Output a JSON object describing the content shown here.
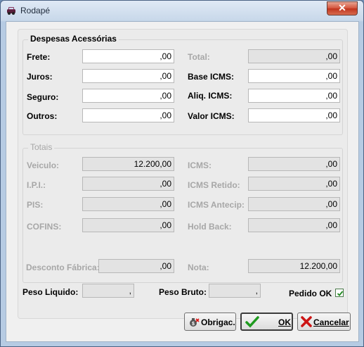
{
  "window": {
    "title": "Rodapé",
    "close_glyph": "✕"
  },
  "despesas": {
    "title": "Despesas Acessórias",
    "left": [
      {
        "label": "Frete:",
        "value": ",00"
      },
      {
        "label": "Juros:",
        "value": ",00"
      },
      {
        "label": "Seguro:",
        "value": ",00"
      },
      {
        "label": "Outros:",
        "value": ",00"
      }
    ],
    "right": [
      {
        "label": "Total:",
        "value": ",00"
      },
      {
        "label": "Base ICMS:",
        "value": ",00"
      },
      {
        "label": "Aliq. ICMS:",
        "value": ",00"
      },
      {
        "label": "Valor ICMS:",
        "value": ",00"
      }
    ]
  },
  "totais": {
    "title": "Totais",
    "left": [
      {
        "label": "Veiculo:",
        "value": "12.200,00"
      },
      {
        "label": "I.P.I.:",
        "value": ",00"
      },
      {
        "label": "PIS:",
        "value": ",00"
      },
      {
        "label": "COFINS:",
        "value": ",00"
      }
    ],
    "right": [
      {
        "label": "ICMS:",
        "value": ",00"
      },
      {
        "label": "ICMS Retido:",
        "value": ",00"
      },
      {
        "label": "ICMS Antecip:",
        "value": ",00"
      },
      {
        "label": "Hold Back:",
        "value": ",00"
      }
    ],
    "desconto": {
      "label": "Desconto Fábrica:",
      "value": ",00"
    },
    "nota": {
      "label": "Nota:",
      "value": "12.200,00"
    }
  },
  "footer": {
    "peso_liquido": {
      "label": "Peso Liquido:",
      "value": ","
    },
    "peso_bruto": {
      "label": "Peso Bruto:",
      "value": ","
    },
    "pedido_ok": {
      "label": "Pedido OK",
      "checked": true
    }
  },
  "buttons": {
    "obrigac": "Obrigac.",
    "ok": "OK",
    "cancelar": "Cancelar"
  },
  "icons": {
    "app": "car-icon",
    "obrigac": "money-bag-icon",
    "ok": "green-check-icon",
    "cancelar": "red-x-icon"
  }
}
